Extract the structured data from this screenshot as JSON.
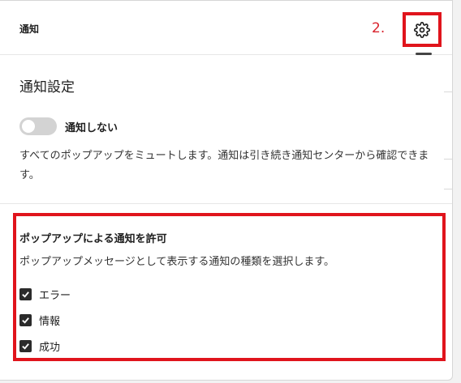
{
  "header": {
    "title": "通知",
    "step_label": "2.",
    "settings_icon": "gear-icon"
  },
  "settings": {
    "title": "通知設定",
    "dnd_toggle": {
      "label": "通知しない",
      "on": false
    },
    "description": "すべてのポップアップをミュートします。通知は引き続き通知センターから確認できます。"
  },
  "popups": {
    "title": "ポップアップによる通知を許可",
    "description": "ポップアップメッセージとして表示する通知の種類を選択します。",
    "options": [
      {
        "label": "エラー",
        "checked": true
      },
      {
        "label": "情報",
        "checked": true
      },
      {
        "label": "成功",
        "checked": true
      }
    ]
  },
  "colors": {
    "highlight": "#e0141c",
    "step_label": "#d9232d",
    "checkbox": "#2b2b2b",
    "toggle_off": "#d3d3d3"
  }
}
